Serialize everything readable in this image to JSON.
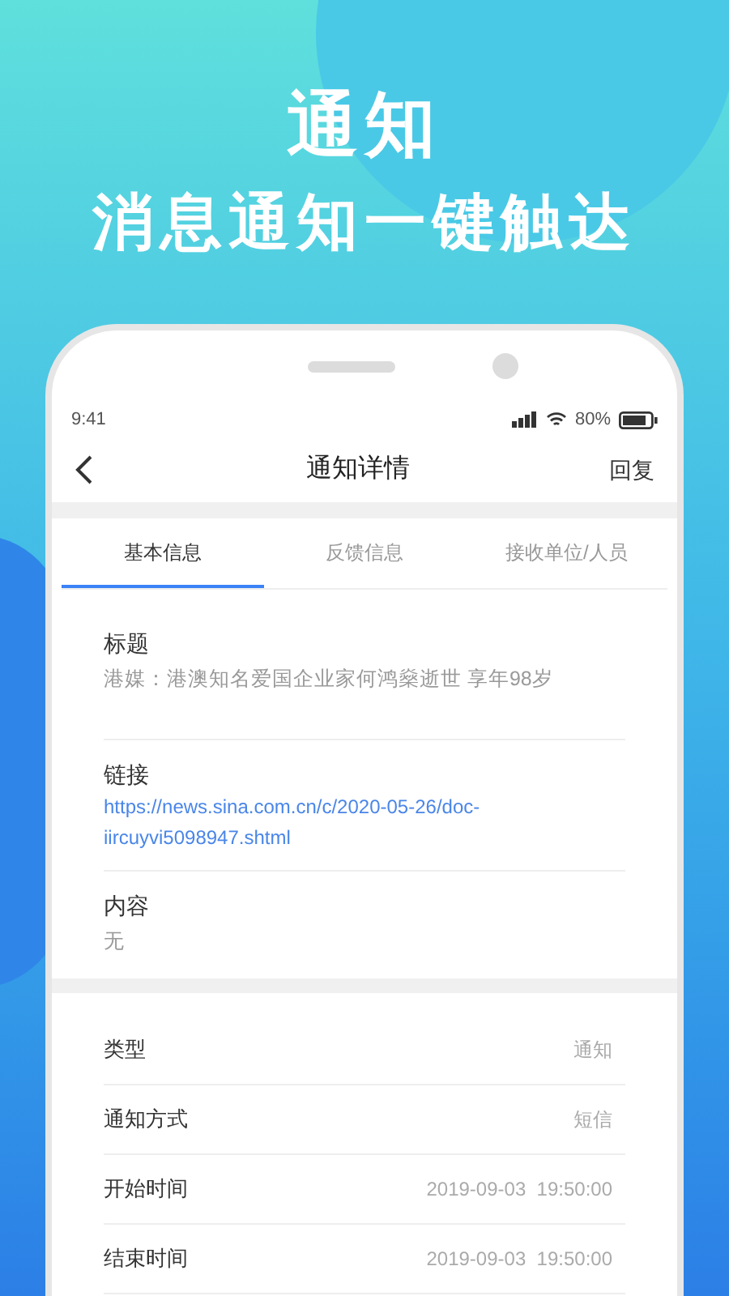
{
  "headline": "通知",
  "subheadline": "消息通知一键触达",
  "status_bar": {
    "time": "9:41",
    "battery": "80%"
  },
  "nav": {
    "title": "通知详情",
    "action": "回复"
  },
  "tabs": [
    {
      "label": "基本信息",
      "selected": true
    },
    {
      "label": "反馈信息",
      "selected": false
    },
    {
      "label": "接收单位/人员",
      "selected": false
    }
  ],
  "details": [
    {
      "label": "标题",
      "value": "港媒：港澳知名爱国企业家何鸿燊逝世 享年98岁",
      "kind": "text"
    },
    {
      "label": "链接",
      "value": "https://news.sina.com.cn/c/2020-05-26/doc-iircuyvi5098947.shtml",
      "kind": "link"
    },
    {
      "label": "内容",
      "value": "无",
      "kind": "text"
    }
  ],
  "info_rows": [
    {
      "label": "类型",
      "value": "通知"
    },
    {
      "label": "通知方式",
      "value": "短信"
    },
    {
      "label": "开始时间",
      "value": "2019-09-03  19:50:00"
    },
    {
      "label": "结束时间",
      "value": "2019-09-03  19:50:00"
    }
  ]
}
